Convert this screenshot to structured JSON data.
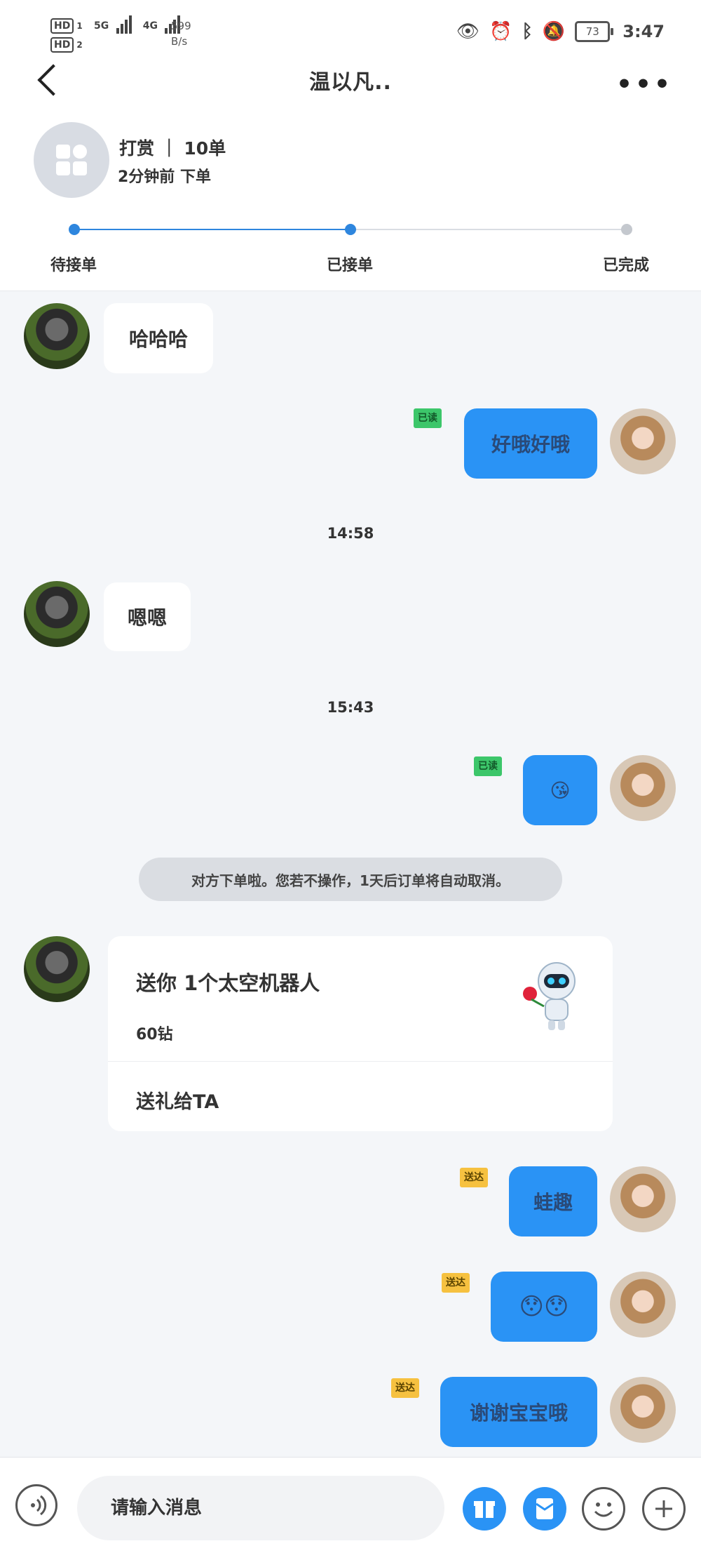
{
  "status_bar": {
    "hd1": "HD",
    "hd1_sub": "1",
    "hd2": "HD",
    "hd2_sub": "2",
    "net1": "5G",
    "net2": "4G",
    "speed_value": "599",
    "speed_unit": "B/s",
    "battery": "73",
    "time": "3:47"
  },
  "header": {
    "title": "温以凡.."
  },
  "order": {
    "type": "打赏 ｜ 10单",
    "time": "2分钟前 下单",
    "steps": [
      "待接单",
      "已接单",
      "已完成"
    ],
    "current_step": 2
  },
  "messages": {
    "m1": "哈哈哈",
    "m2": "好哦好哦",
    "m2_status": "已读",
    "t1": "14:58",
    "m3": "嗯嗯",
    "t2": "15:43",
    "m4": "😘",
    "m4_status": "已读",
    "system_note": "对方下单啦。您若不操作，1天后订单将自动取消。",
    "m5": "蛙趣",
    "m5_status": "送达",
    "m6": "😯😯",
    "m6_status": "送达",
    "m7": "谢谢宝宝哦",
    "m7_status": "送达"
  },
  "gift": {
    "title": "送你 1个太空机器人",
    "price": "60钻",
    "action": "送礼给TA"
  },
  "input": {
    "placeholder": "请输入消息"
  },
  "colors": {
    "accent": "#2a93f5",
    "read_badge": "#3cc66a",
    "sent_badge": "#f6c140"
  }
}
